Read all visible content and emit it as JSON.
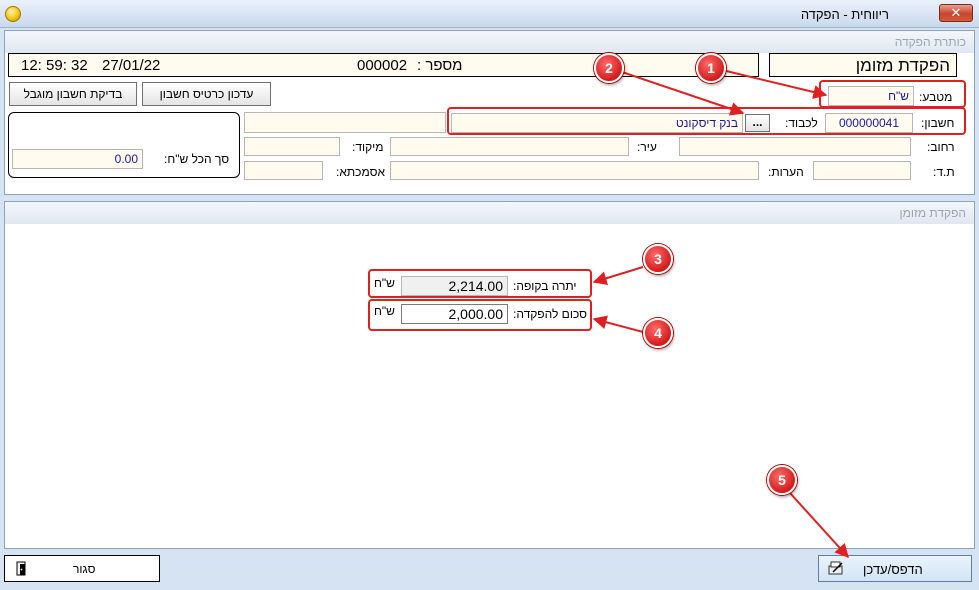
{
  "window": {
    "title": "ריווחית - הפקדה",
    "close_glyph": "✕"
  },
  "header_panel": {
    "section_title": "כותרת הפקדה",
    "time": "12: 59: 32",
    "date": "27/01/22",
    "number_label": "מספר :",
    "number_value": "000002",
    "doc_title": "הפקדת מזומן",
    "buttons": {
      "account_check": "בדיקת חשבון מוגבל",
      "update_card": "עדכון כרטיס חשבון"
    },
    "currency_label": "מטבע:",
    "currency_value": "ש\"ח",
    "total_label": "סך הכל ש\"ח:",
    "total_value": "0.00",
    "account_label": "חשבון:",
    "account_value": "000000041",
    "to_label": "לכבוד:",
    "ellipsis_button": "...",
    "to_value": "בנק דיסקונט",
    "street_label": "רחוב:",
    "city_label": "עיר:",
    "zip_label": "מיקוד:",
    "id_label": "ת.ד:",
    "notes_label": "הערות:",
    "reference_label": "אסמכתא:"
  },
  "deposit_panel": {
    "section_title": "הפקדת מזומן",
    "balance_label": "יתרה בקופה:",
    "balance_value": "2,214.00",
    "balance_currency": "ש\"ח",
    "amount_label": "סכום להפקדה:",
    "amount_value": "2,000.00",
    "amount_currency": "ש\"ח"
  },
  "footer": {
    "close_label": "סגור",
    "print_update_label": "הדפס/עדכן"
  },
  "callouts": [
    "1",
    "2",
    "3",
    "4",
    "5"
  ],
  "colors": {
    "callout_red": "#d31b1b",
    "highlight_red": "#e02020",
    "value_blue": "#1a1aa0"
  }
}
